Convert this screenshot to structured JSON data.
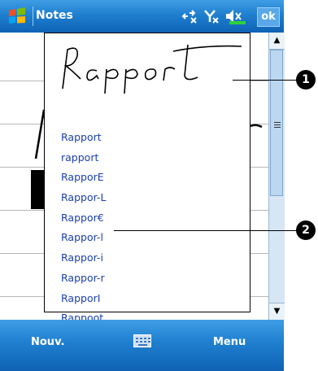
{
  "titlebar": {
    "app_title": "Notes",
    "ok_label": "ok"
  },
  "icons": {
    "start": "windows-flag-icon",
    "connectivity": "connectivity-icon",
    "signal": "signal-icon",
    "volume": "volume-icon"
  },
  "note": {
    "handwriting_text": "Rapport"
  },
  "candidates": [
    "Rapport",
    "rapport",
    "RapporE",
    "Rappor-L",
    "Rappor€",
    "Rappor-l",
    "Rappor-i",
    "Rappor-r",
    "RapporI",
    "Rappoot"
  ],
  "callouts": {
    "one": "1",
    "two": "2"
  },
  "bottombar": {
    "left_label": "Nouv.",
    "right_label": "Menu"
  }
}
